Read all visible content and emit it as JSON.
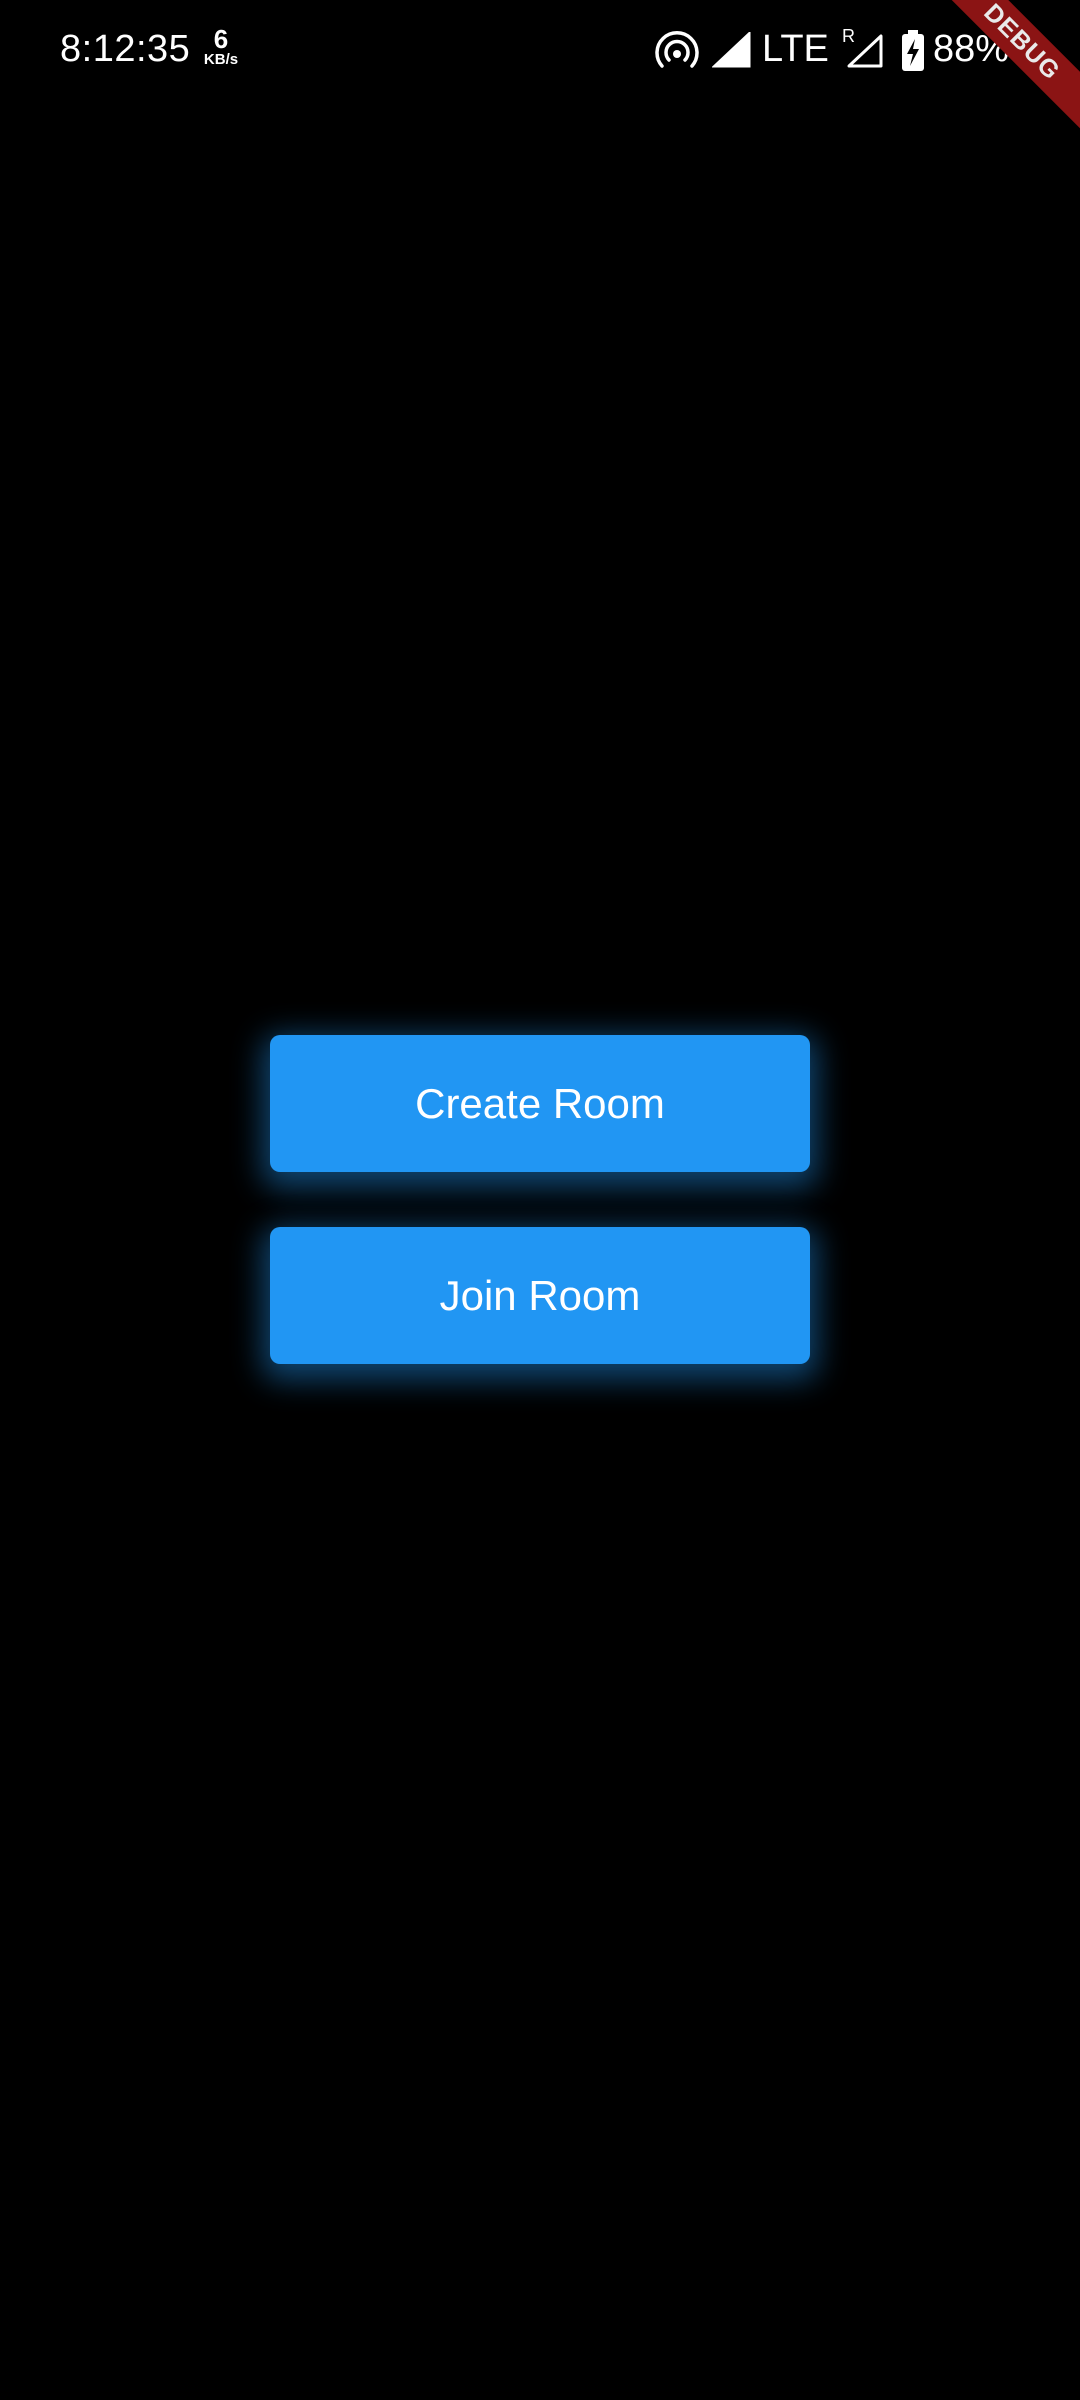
{
  "status_bar": {
    "time": "8:12:35",
    "net_speed_value": "6",
    "net_speed_unit": "KB/s",
    "network_type": "LTE",
    "roaming_indicator": "R",
    "battery_percent": "88%",
    "icons": [
      "hotspot-icon",
      "signal-icon",
      "signal-roaming-icon",
      "battery-charging-icon"
    ]
  },
  "debug_banner": {
    "label": "DEBUG",
    "color": "#8b1414"
  },
  "actions": {
    "create_room_label": "Create Room",
    "join_room_label": "Join Room"
  },
  "theme": {
    "background": "#000000",
    "button_color": "#2196f3",
    "text_color": "#ffffff"
  }
}
